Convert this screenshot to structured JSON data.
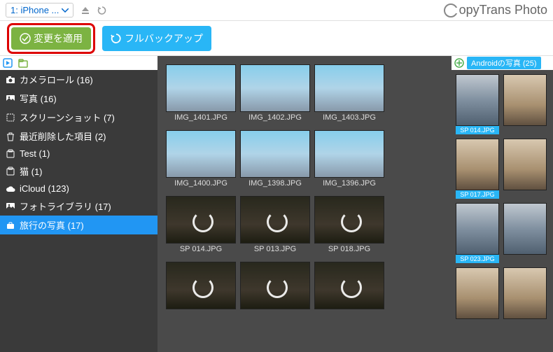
{
  "header": {
    "device": "1: iPhone ...",
    "appName": "opyTrans Photo"
  },
  "actions": {
    "apply": "変更を適用",
    "backup": "フルバックアップ"
  },
  "sidebar": {
    "items": [
      {
        "icon": "camera",
        "label": "カメラロール (16)"
      },
      {
        "icon": "photo",
        "label": "写真 (16)"
      },
      {
        "icon": "screenshot",
        "label": "スクリーンショット (7)"
      },
      {
        "icon": "trash",
        "label": "最近削除した項目 (2)"
      },
      {
        "icon": "album",
        "label": "Test (1)"
      },
      {
        "icon": "album",
        "label": "猫 (1)"
      },
      {
        "icon": "cloud",
        "label": "iCloud (123)"
      },
      {
        "icon": "photo",
        "label": "フォトライブラリ (17)"
      },
      {
        "icon": "travel",
        "label": "旅行の写真 (17)",
        "selected": true
      }
    ]
  },
  "center": {
    "thumbs": [
      {
        "label": "IMG_1401.JPG",
        "style": "sky"
      },
      {
        "label": "IMG_1402.JPG",
        "style": "sky"
      },
      {
        "label": "IMG_1403.JPG",
        "style": "sky"
      },
      {
        "label": "IMG_1400.JPG",
        "style": "sky"
      },
      {
        "label": "IMG_1398.JPG",
        "style": "sky"
      },
      {
        "label": "IMG_1396.JPG",
        "style": "sky"
      },
      {
        "label": "SP 014.JPG",
        "style": "dark",
        "sync": true
      },
      {
        "label": "SP 013.JPG",
        "style": "dark",
        "sync": true
      },
      {
        "label": "SP 018.JPG",
        "style": "dark",
        "sync": true
      },
      {
        "label": "",
        "style": "dark",
        "sync": true
      },
      {
        "label": "",
        "style": "dark",
        "sync": true
      },
      {
        "label": "",
        "style": "dark",
        "sync": true
      }
    ]
  },
  "right": {
    "header": "Androidの写真 (25)",
    "thumbs": [
      {
        "label": "SP 014.JPG",
        "style": "cool"
      },
      {
        "label": "",
        "style": "warm"
      },
      {
        "label": "SP 017.JPG",
        "style": "warm"
      },
      {
        "label": "",
        "style": "warm"
      },
      {
        "label": "SP 023.JPG",
        "style": "cool"
      },
      {
        "label": "",
        "style": "cool"
      },
      {
        "label": "",
        "style": "warm"
      },
      {
        "label": "",
        "style": "warm"
      }
    ]
  }
}
